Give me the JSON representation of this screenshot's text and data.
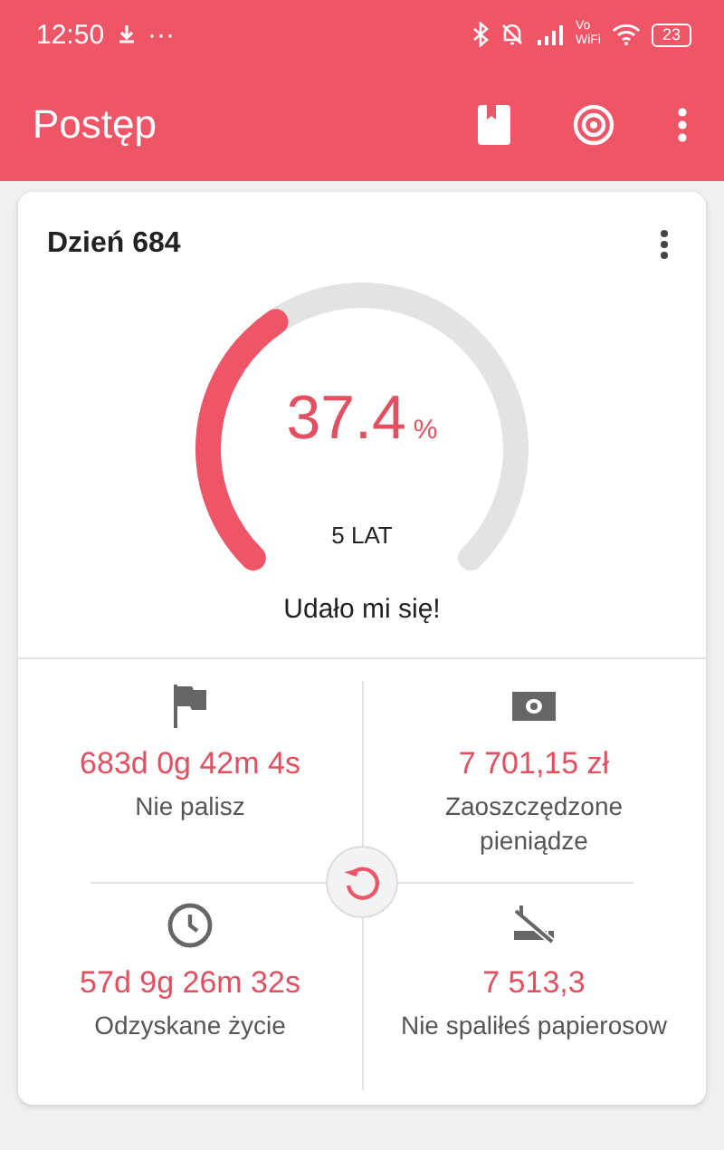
{
  "status_bar": {
    "time": "12:50",
    "more": "···",
    "volte": [
      "Vo",
      "WiFi"
    ],
    "battery": "23"
  },
  "app_bar": {
    "title": "Postęp"
  },
  "card": {
    "title": "Dzień 684",
    "gauge": {
      "value": "37.4",
      "unit": "%",
      "caption": "5 LAT"
    },
    "message": "Udało mi się!"
  },
  "stats": [
    {
      "kind": "flag",
      "value": "683d 0g 42m 4s",
      "label": "Nie palisz"
    },
    {
      "kind": "money",
      "value": "7 701,15 zł",
      "label": "Zaoszczędzone pieniądze"
    },
    {
      "kind": "clock",
      "value": "57d 9g 26m 32s",
      "label": "Odzyskane życie"
    },
    {
      "kind": "no-smoking",
      "value": "7 513,3",
      "label": "Nie spaliłeś papierosow"
    }
  ]
}
